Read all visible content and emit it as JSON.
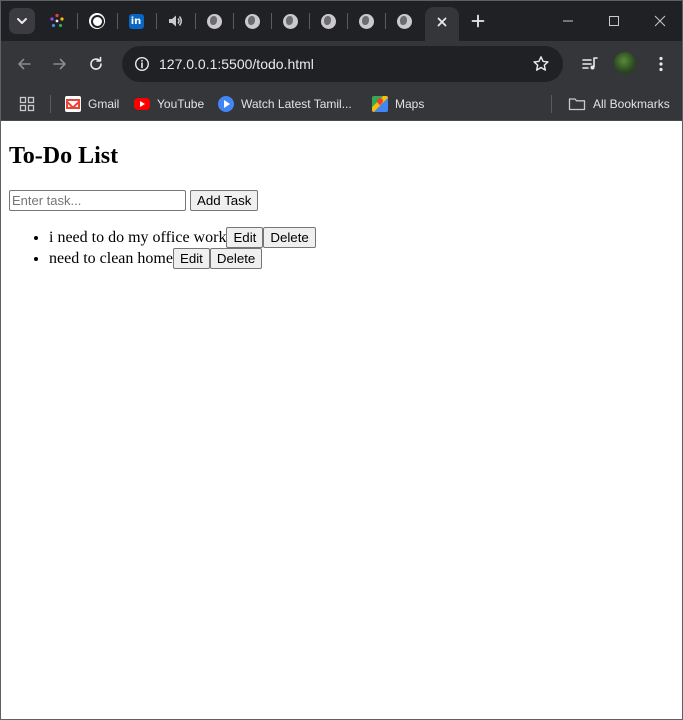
{
  "browser": {
    "tabs": [
      {
        "icon": "spark-icon"
      },
      {
        "icon": "openai-icon"
      },
      {
        "icon": "linkedin-icon",
        "glyph": "in"
      },
      {
        "icon": "speaker-icon"
      },
      {
        "icon": "globe-icon"
      },
      {
        "icon": "globe-icon"
      },
      {
        "icon": "globe-icon"
      },
      {
        "icon": "globe-icon"
      },
      {
        "icon": "globe-icon"
      },
      {
        "icon": "globe-icon"
      },
      {
        "icon": "close-icon",
        "active": true
      }
    ],
    "url": "127.0.0.1:5500/todo.html",
    "bookmarks": [
      {
        "label": "Gmail",
        "icon": "gmail-icon"
      },
      {
        "label": "YouTube",
        "icon": "youtube-icon"
      },
      {
        "label": "Watch Latest Tamil...",
        "icon": "play-icon"
      },
      {
        "label": "Maps",
        "icon": "maps-icon"
      }
    ],
    "all_bookmarks_label": "All Bookmarks",
    "colors": {
      "tabstrip": "#202124",
      "toolbar": "#35363a",
      "omnibox": "#202124"
    }
  },
  "page": {
    "title": "To-Do List",
    "input_placeholder": "Enter task...",
    "add_button": "Add Task",
    "tasks": [
      {
        "text": "i need to do my office work",
        "edit": "Edit",
        "delete": "Delete"
      },
      {
        "text": "need to clean home",
        "edit": "Edit",
        "delete": "Delete"
      }
    ]
  }
}
